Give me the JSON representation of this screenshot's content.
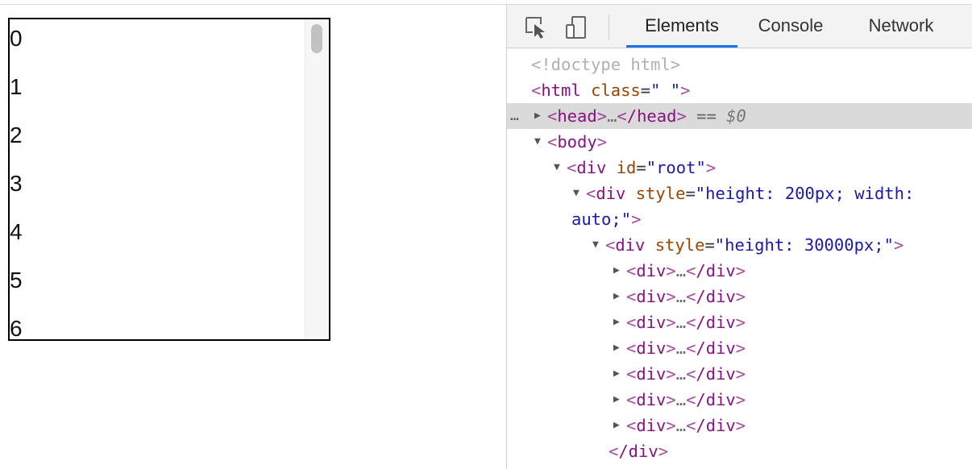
{
  "viewport": {
    "items": [
      "0",
      "1",
      "2",
      "3",
      "4",
      "5",
      "6"
    ]
  },
  "devtools": {
    "tabs": [
      {
        "label": "Elements",
        "active": true
      },
      {
        "label": "Console",
        "active": false
      },
      {
        "label": "Network",
        "active": false
      }
    ],
    "icons": [
      "inspect-element-icon",
      "device-toolbar-icon"
    ],
    "dom_tree": {
      "doctype": "<!doctype html>",
      "html_open": {
        "tag": "html",
        "attr": "class",
        "value": "\" \""
      },
      "head_row": {
        "tag": "head",
        "ellipsis": "…",
        "close": "/head",
        "eq": "==",
        "var": "$0",
        "prefix": "…"
      },
      "body_open": {
        "tag": "body"
      },
      "root_div": {
        "tag": "div",
        "attr": "id",
        "value": "\"root\""
      },
      "outer_div": {
        "tag": "div",
        "attr": "style",
        "value_line1": "\"height: 200px; width:",
        "value_line2": "auto;\""
      },
      "inner_div": {
        "tag": "div",
        "attr": "style",
        "value": "\"height: 30000px;\""
      },
      "child_rows": [
        {
          "tag": "div",
          "ellipsis": "…",
          "close": "/div"
        },
        {
          "tag": "div",
          "ellipsis": "…",
          "close": "/div"
        },
        {
          "tag": "div",
          "ellipsis": "…",
          "close": "/div"
        },
        {
          "tag": "div",
          "ellipsis": "…",
          "close": "/div"
        },
        {
          "tag": "div",
          "ellipsis": "…",
          "close": "/div"
        },
        {
          "tag": "div",
          "ellipsis": "…",
          "close": "/div"
        },
        {
          "tag": "div",
          "ellipsis": "…",
          "close": "/div"
        }
      ],
      "inner_close": "/div"
    }
  },
  "colors": {
    "tab_active_underline": "#1a73e8",
    "selected_row": "#dadada",
    "tag": "#881280",
    "attr_name": "#994500",
    "attr_value": "#1a1aa6"
  }
}
